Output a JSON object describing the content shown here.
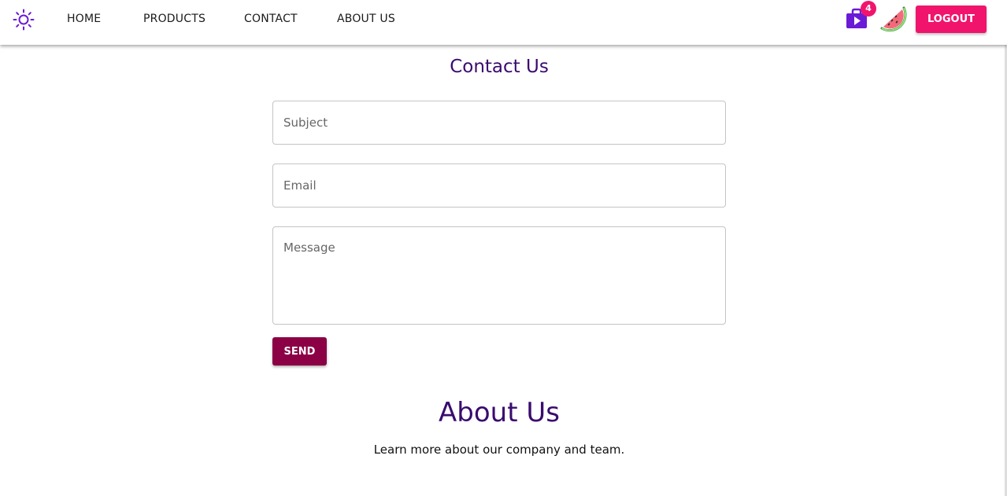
{
  "nav": {
    "theme_icon": "sun-icon",
    "links": [
      "HOME",
      "PRODUCTS",
      "CONTACT",
      "ABOUT US"
    ],
    "cart_icon": "shopping-bag-play-icon",
    "cart_count": "4",
    "avatar_icon": "watermelon-avatar-icon",
    "logout_label": "LOGOUT"
  },
  "contact": {
    "title": "Contact Us",
    "subject_placeholder": "Subject",
    "email_placeholder": "Email",
    "message_placeholder": "Message",
    "send_label": "SEND"
  },
  "about": {
    "title": "About Us",
    "text": "Learn more about our company and team."
  },
  "colors": {
    "accent_pink": "#f0146c",
    "send_button": "#8c0046",
    "heading": "#3a0b6e",
    "icon_purple": "#6a1bd6"
  }
}
